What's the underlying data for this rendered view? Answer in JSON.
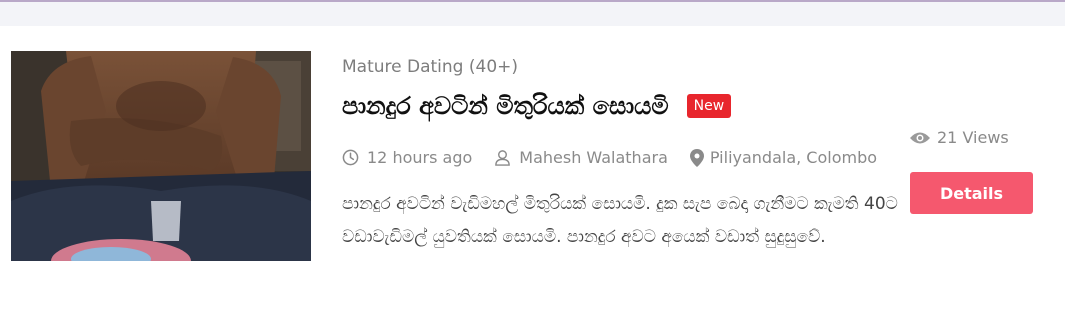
{
  "listing": {
    "category": "Mature Dating (40+)",
    "title": "පානදුර අවටින් මිතුරියක් සොයමි",
    "badge": "New",
    "meta": {
      "time": "12 hours ago",
      "author": "Mahesh Walathara",
      "location": "Piliyandala, Colombo"
    },
    "description": "පානදුර අවටින් වැඩිමහල් මිතුරියක් සොයමි. දුක සැප බෙදා ගැනීමට කැමති 40ට වඩාවැඩිමල් යුවතියක් සොයමි. පානදුර අවට අයෙක් වඩාත් සුදුසුවේ.",
    "views": "21 Views",
    "details_label": "Details",
    "icons": {
      "time": "clock-icon",
      "author": "user-icon",
      "location": "map-pin-icon",
      "views": "eye-icon"
    }
  },
  "colors": {
    "badge": "#e8262d",
    "button": "#f5586e",
    "muted": "#8a8a8a"
  }
}
